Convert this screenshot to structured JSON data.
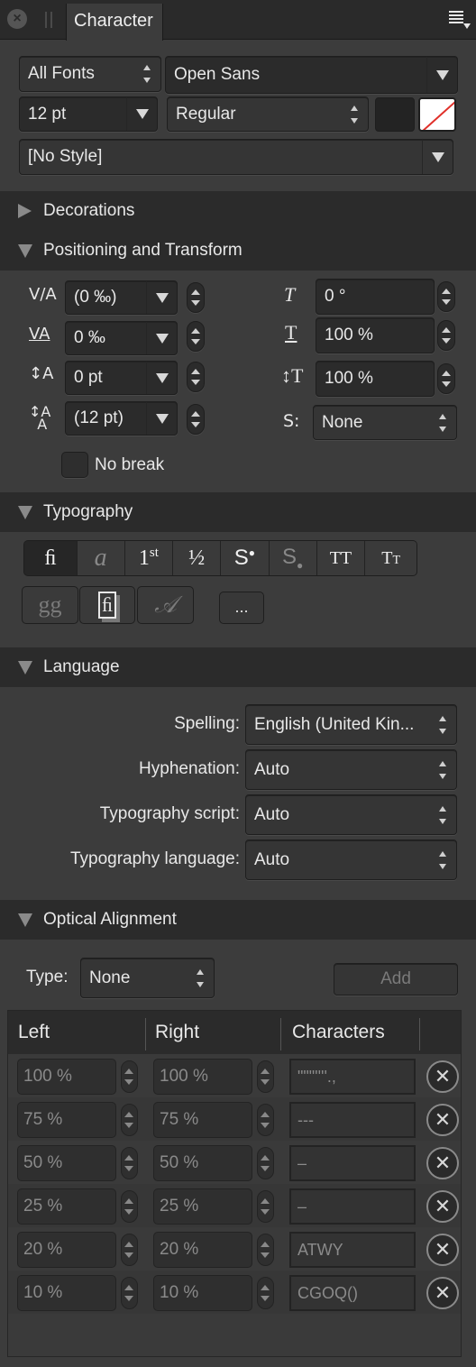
{
  "tabbar": {
    "close_icon": "close-circle-icon",
    "grip_icon": "grip-icon",
    "tab_label": "Character",
    "menu_icon": "panel-menu-icon"
  },
  "font": {
    "collection": "All Fonts",
    "family": "Open Sans",
    "size": "12 pt",
    "style": "Regular",
    "fill_color": "#232323",
    "stroke_color": "none",
    "paragraph_style": "[No Style]"
  },
  "sections": {
    "decorations": "Decorations",
    "positioning": "Positioning and Transform",
    "typography": "Typography",
    "language": "Language",
    "optical": "Optical Alignment"
  },
  "positioning": {
    "kerning": "(0 ‰)",
    "tracking": "0 ‰",
    "baseline": "0 pt",
    "leading": "(12 pt)",
    "shear": "0 °",
    "horizontal_scale": "100 %",
    "vertical_scale": "100 %",
    "script": "None",
    "no_break_label": "No break",
    "no_break_checked": false
  },
  "typography": {
    "buttons": [
      {
        "glyph": "ﬁ",
        "name": "standard-ligatures",
        "active": true
      },
      {
        "glyph": "a",
        "name": "swash",
        "active": false
      },
      {
        "glyph": "1st",
        "name": "ordinals",
        "active": false
      },
      {
        "glyph": "½",
        "name": "fractions",
        "active": false
      },
      {
        "glyph": "S•",
        "name": "superscript",
        "active": false
      },
      {
        "glyph": "S.",
        "name": "subscript",
        "active": false
      },
      {
        "glyph": "TT",
        "name": "all-caps",
        "active": false
      },
      {
        "glyph": "Tт",
        "name": "small-caps",
        "active": false
      }
    ],
    "row2": [
      {
        "glyph": "gg",
        "name": "stylistic-alternates"
      },
      {
        "glyph": "ﬁ",
        "name": "discretionary-ligatures"
      },
      {
        "glyph": "𝒜",
        "name": "contextual-alternates"
      }
    ],
    "more_label": "..."
  },
  "language": {
    "rows": [
      {
        "label": "Spelling:",
        "value": "English (United Kin..."
      },
      {
        "label": "Hyphenation:",
        "value": "Auto"
      },
      {
        "label": "Typography script:",
        "value": "Auto"
      },
      {
        "label": "Typography language:",
        "value": "Auto"
      }
    ]
  },
  "optical": {
    "type_label": "Type:",
    "type_value": "None",
    "add_label": "Add",
    "columns": [
      "Left",
      "Right",
      "Characters"
    ],
    "rows": [
      {
        "left": "100 %",
        "right": "100 %",
        "chars": "\"\"\"''''.,"
      },
      {
        "left": "75 %",
        "right": "75 %",
        "chars": "---"
      },
      {
        "left": "50 %",
        "right": "50 %",
        "chars": "–"
      },
      {
        "left": "25 %",
        "right": "25 %",
        "chars": "–"
      },
      {
        "left": "20 %",
        "right": "20 %",
        "chars": "ATWY"
      },
      {
        "left": "10 %",
        "right": "10 %",
        "chars": "CGOQ()"
      }
    ]
  }
}
